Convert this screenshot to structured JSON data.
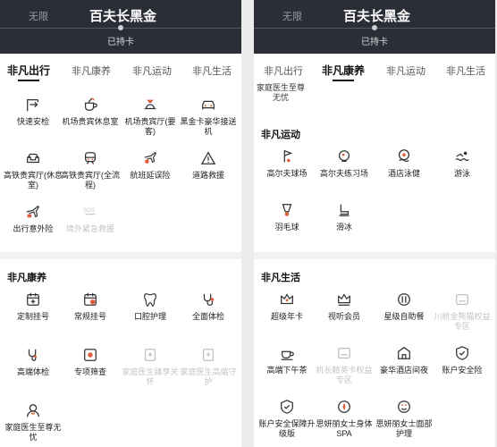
{
  "left": {
    "header": {
      "prev": "无限",
      "title": "百夫长黑金",
      "status": "已持卡"
    },
    "tabs": [
      {
        "label": "非凡出行"
      },
      {
        "label": "非凡康养"
      },
      {
        "label": "非凡运动"
      },
      {
        "label": "非凡生活"
      }
    ],
    "sections": {
      "travel": "非凡出行",
      "health": "非凡康养"
    },
    "travel_items": [
      {
        "label": "快速安检"
      },
      {
        "label": "机场贵宾休息室"
      },
      {
        "label": "机场贵宾厅(要客)"
      },
      {
        "label": "黑金卡豪华接送机"
      },
      {
        "label": "高铁贵宾厅(休息室)"
      },
      {
        "label": "高铁贵宾厅(全流程)"
      },
      {
        "label": "航班延误险"
      },
      {
        "label": "道路救援"
      },
      {
        "label": "出行意外险"
      },
      {
        "label": "境外紧急救援"
      }
    ],
    "health_items": [
      {
        "label": "定制挂号"
      },
      {
        "label": "常规挂号"
      },
      {
        "label": "口腔护理"
      },
      {
        "label": "全面体检"
      },
      {
        "label": "高端体检"
      },
      {
        "label": "专项筛查"
      },
      {
        "label": "家庭医生臻享关怀"
      },
      {
        "label": "家庭医生高端守护"
      },
      {
        "label": "家庭医生至尊无忧"
      }
    ]
  },
  "right": {
    "header": {
      "prev": "无限",
      "title": "百夫长黑金",
      "status": "已持卡"
    },
    "tabs": [
      {
        "label": "非凡出行"
      },
      {
        "label": "非凡康养"
      },
      {
        "label": "非凡运动"
      },
      {
        "label": "非凡生活"
      }
    ],
    "fragment": "家庭医生至尊无忧",
    "sections": {
      "sport": "非凡运动",
      "life": "非凡生活"
    },
    "sport_items": [
      {
        "label": "高尔夫球场"
      },
      {
        "label": "高尔夫练习场"
      },
      {
        "label": "酒店泳健"
      },
      {
        "label": "游泳"
      },
      {
        "label": "羽毛球"
      },
      {
        "label": "滑冰"
      }
    ],
    "life_items": [
      {
        "label": "超级年卡"
      },
      {
        "label": "视听会员"
      },
      {
        "label": "星级自助餐"
      },
      {
        "label": "川航金熊猫权益专区"
      },
      {
        "label": "高端下午茶"
      },
      {
        "label": "机长精英卡权益专区"
      },
      {
        "label": "豪华酒店间夜"
      },
      {
        "label": "账户安全险"
      },
      {
        "label": "账户安全保障升级版"
      },
      {
        "label": "思妍丽女士身体SPA"
      },
      {
        "label": "思妍丽女士面部护理"
      }
    ]
  },
  "colors": {
    "header_bg": "#2b2e37",
    "accent": "#111111",
    "disabled": "#c4c4c4"
  }
}
